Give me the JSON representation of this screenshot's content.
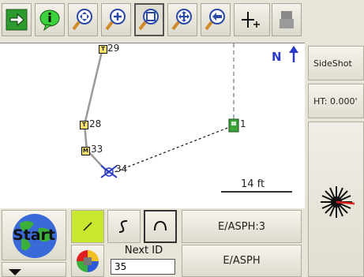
{
  "toolbar": {
    "buttons": [
      {
        "name": "next-arrow",
        "icon": "arrow-right-icon"
      },
      {
        "name": "info",
        "icon": "info-bubble-icon"
      },
      {
        "name": "zoom-extents",
        "icon": "zoom-extents-icon"
      },
      {
        "name": "zoom-out",
        "icon": "zoom-out-icon"
      },
      {
        "name": "zoom-window",
        "icon": "zoom-window-icon"
      },
      {
        "name": "pan",
        "icon": "pan-icon"
      },
      {
        "name": "zoom-previous",
        "icon": "zoom-previous-icon"
      },
      {
        "name": "add-point",
        "icon": "crosshair-plus-icon"
      },
      {
        "name": "surveyor",
        "icon": "surveyor-icon"
      }
    ]
  },
  "map": {
    "north_label": "N",
    "points": [
      {
        "id": "29",
        "code": "T"
      },
      {
        "id": "28",
        "code": "T"
      },
      {
        "id": "33",
        "code": "M"
      },
      {
        "id": "34",
        "code": ""
      },
      {
        "id": "1",
        "code": ""
      }
    ],
    "scale_label": "14 ft"
  },
  "side": {
    "sideshot_label": "SideShot",
    "ht_label": "HT: 0.000'"
  },
  "bottom": {
    "start_label": "Start",
    "code_top": "E/ASPH:3",
    "code_bottom": "E/ASPH",
    "next_id_label": "Next ID",
    "next_id_value": "35"
  },
  "colors": {
    "accent_green": "#3aa33a",
    "line_gray": "#a0a0a0",
    "shot_red": "#e02020"
  }
}
